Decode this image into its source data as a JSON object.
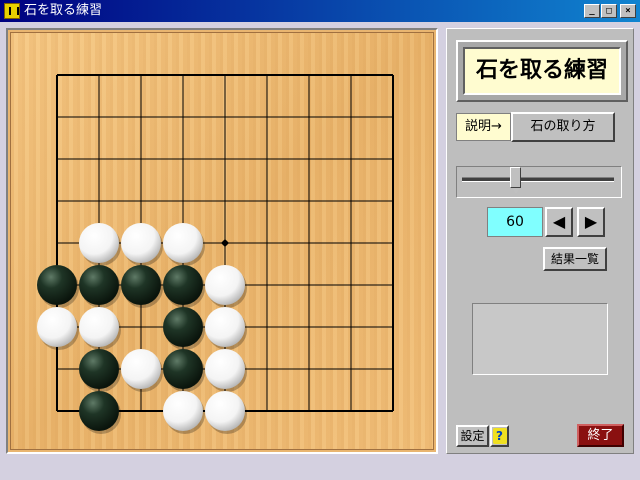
{
  "window": {
    "title": "石を取る練習",
    "minimize": "_",
    "maximize": "□",
    "close": "×"
  },
  "panel": {
    "logo_text": "石を取る練習",
    "explain_label": "説明→",
    "explain_button": "石の取り方",
    "slider_value": 0.35,
    "counter_value": "60",
    "prev_label": "◀",
    "next_label": "▶",
    "results_button": "結果一覧",
    "settings_button": "設定",
    "help_button": "?",
    "quit_button": "終了"
  },
  "board": {
    "columns": 9,
    "rows": 9,
    "star_point": [
      4,
      4
    ],
    "stones": [
      {
        "color": "white",
        "col": 1,
        "row": 4
      },
      {
        "color": "white",
        "col": 2,
        "row": 4
      },
      {
        "color": "white",
        "col": 3,
        "row": 4
      },
      {
        "color": "black",
        "col": 0,
        "row": 5
      },
      {
        "color": "black",
        "col": 1,
        "row": 5
      },
      {
        "color": "black",
        "col": 2,
        "row": 5
      },
      {
        "color": "black",
        "col": 3,
        "row": 5
      },
      {
        "color": "white",
        "col": 4,
        "row": 5
      },
      {
        "color": "white",
        "col": 0,
        "row": 6
      },
      {
        "color": "white",
        "col": 1,
        "row": 6
      },
      {
        "color": "black",
        "col": 3,
        "row": 6
      },
      {
        "color": "white",
        "col": 4,
        "row": 6
      },
      {
        "color": "black",
        "col": 1,
        "row": 7
      },
      {
        "color": "white",
        "col": 2,
        "row": 7
      },
      {
        "color": "black",
        "col": 3,
        "row": 7
      },
      {
        "color": "white",
        "col": 4,
        "row": 7
      },
      {
        "color": "black",
        "col": 1,
        "row": 8
      },
      {
        "color": "white",
        "col": 3,
        "row": 8
      },
      {
        "color": "white",
        "col": 4,
        "row": 8
      }
    ]
  },
  "colors": {
    "board": "#eab56c",
    "black_stone": "#1f3526",
    "white_stone": "#f4f4f4",
    "counter_bg": "#80ffff",
    "quit_bg": "#8a1010"
  }
}
